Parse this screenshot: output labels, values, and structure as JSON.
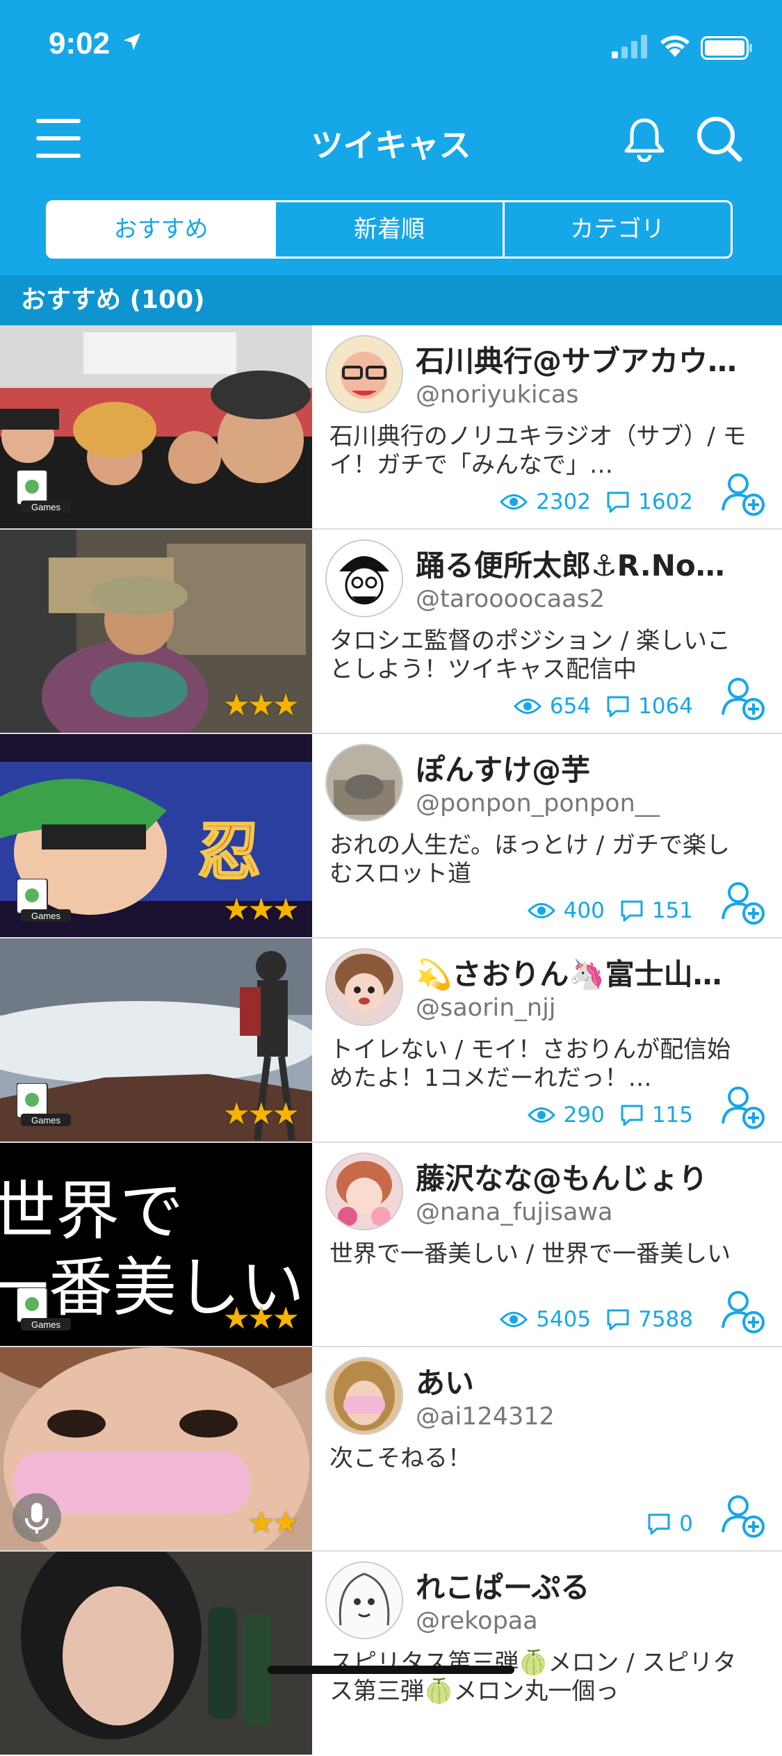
{
  "status_bar": {
    "time": "9:02"
  },
  "header": {
    "title": "ツイキャス",
    "tabs": [
      {
        "label": "おすすめ",
        "active": true
      },
      {
        "label": "新着順",
        "active": false
      },
      {
        "label": "カテゴリ",
        "active": false
      }
    ]
  },
  "section": {
    "title": "おすすめ (100)"
  },
  "accent_color": "#16a7e8",
  "streams": [
    {
      "name": "石川典行@サブアカウ…",
      "handle": "@noriyukicas",
      "description": "石川典行のノリユキラジオ（サブ）/ モイ！ガチで「みんなで」…",
      "views": "2302",
      "comments": "1602",
      "badge": "Games",
      "stars": ""
    },
    {
      "name": "踊る便所太郎⚓R.No…",
      "handle": "@taroooocaas2",
      "description": "タロシエ監督のポジション / 楽しいことしよう！ツイキャス配信中",
      "views": "654",
      "comments": "1064",
      "badge": "",
      "stars": "★★★"
    },
    {
      "name": "ぽんすけ@芋",
      "handle": "@ponpon_ponpon__",
      "description": "おれの人生だ。ほっとけ / ガチで楽しむスロット道",
      "views": "400",
      "comments": "151",
      "badge": "Games",
      "stars": "★★★"
    },
    {
      "name": "💫さおりん🦄富士山…",
      "handle": "@saorin_njj",
      "description": "トイレない / モイ！さおりんが配信始めたよ！1コメだーれだっ！…",
      "views": "290",
      "comments": "115",
      "badge": "Games",
      "stars": "★★★"
    },
    {
      "name": "藤沢なな@もんじょり",
      "handle": "@nana_fujisawa",
      "description": "世界で一番美しい / 世界で一番美しい",
      "views": "5405",
      "comments": "7588",
      "badge": "Games",
      "stars": "★★★",
      "thumb_text_1": "世界で",
      "thumb_text_2": "一番美しい"
    },
    {
      "name": "あい",
      "handle": "@ai124312",
      "description": "次こそねる！",
      "views": "",
      "comments": "0",
      "badge": "",
      "stars": "★★"
    },
    {
      "name": "れこぱーぷる",
      "handle": "@rekopaa",
      "description": "スピリタス第三弾🍈メロン / スピリタス第三弾🍈メロン丸一個っ",
      "views": "",
      "comments": "",
      "badge": "",
      "stars": ""
    }
  ]
}
